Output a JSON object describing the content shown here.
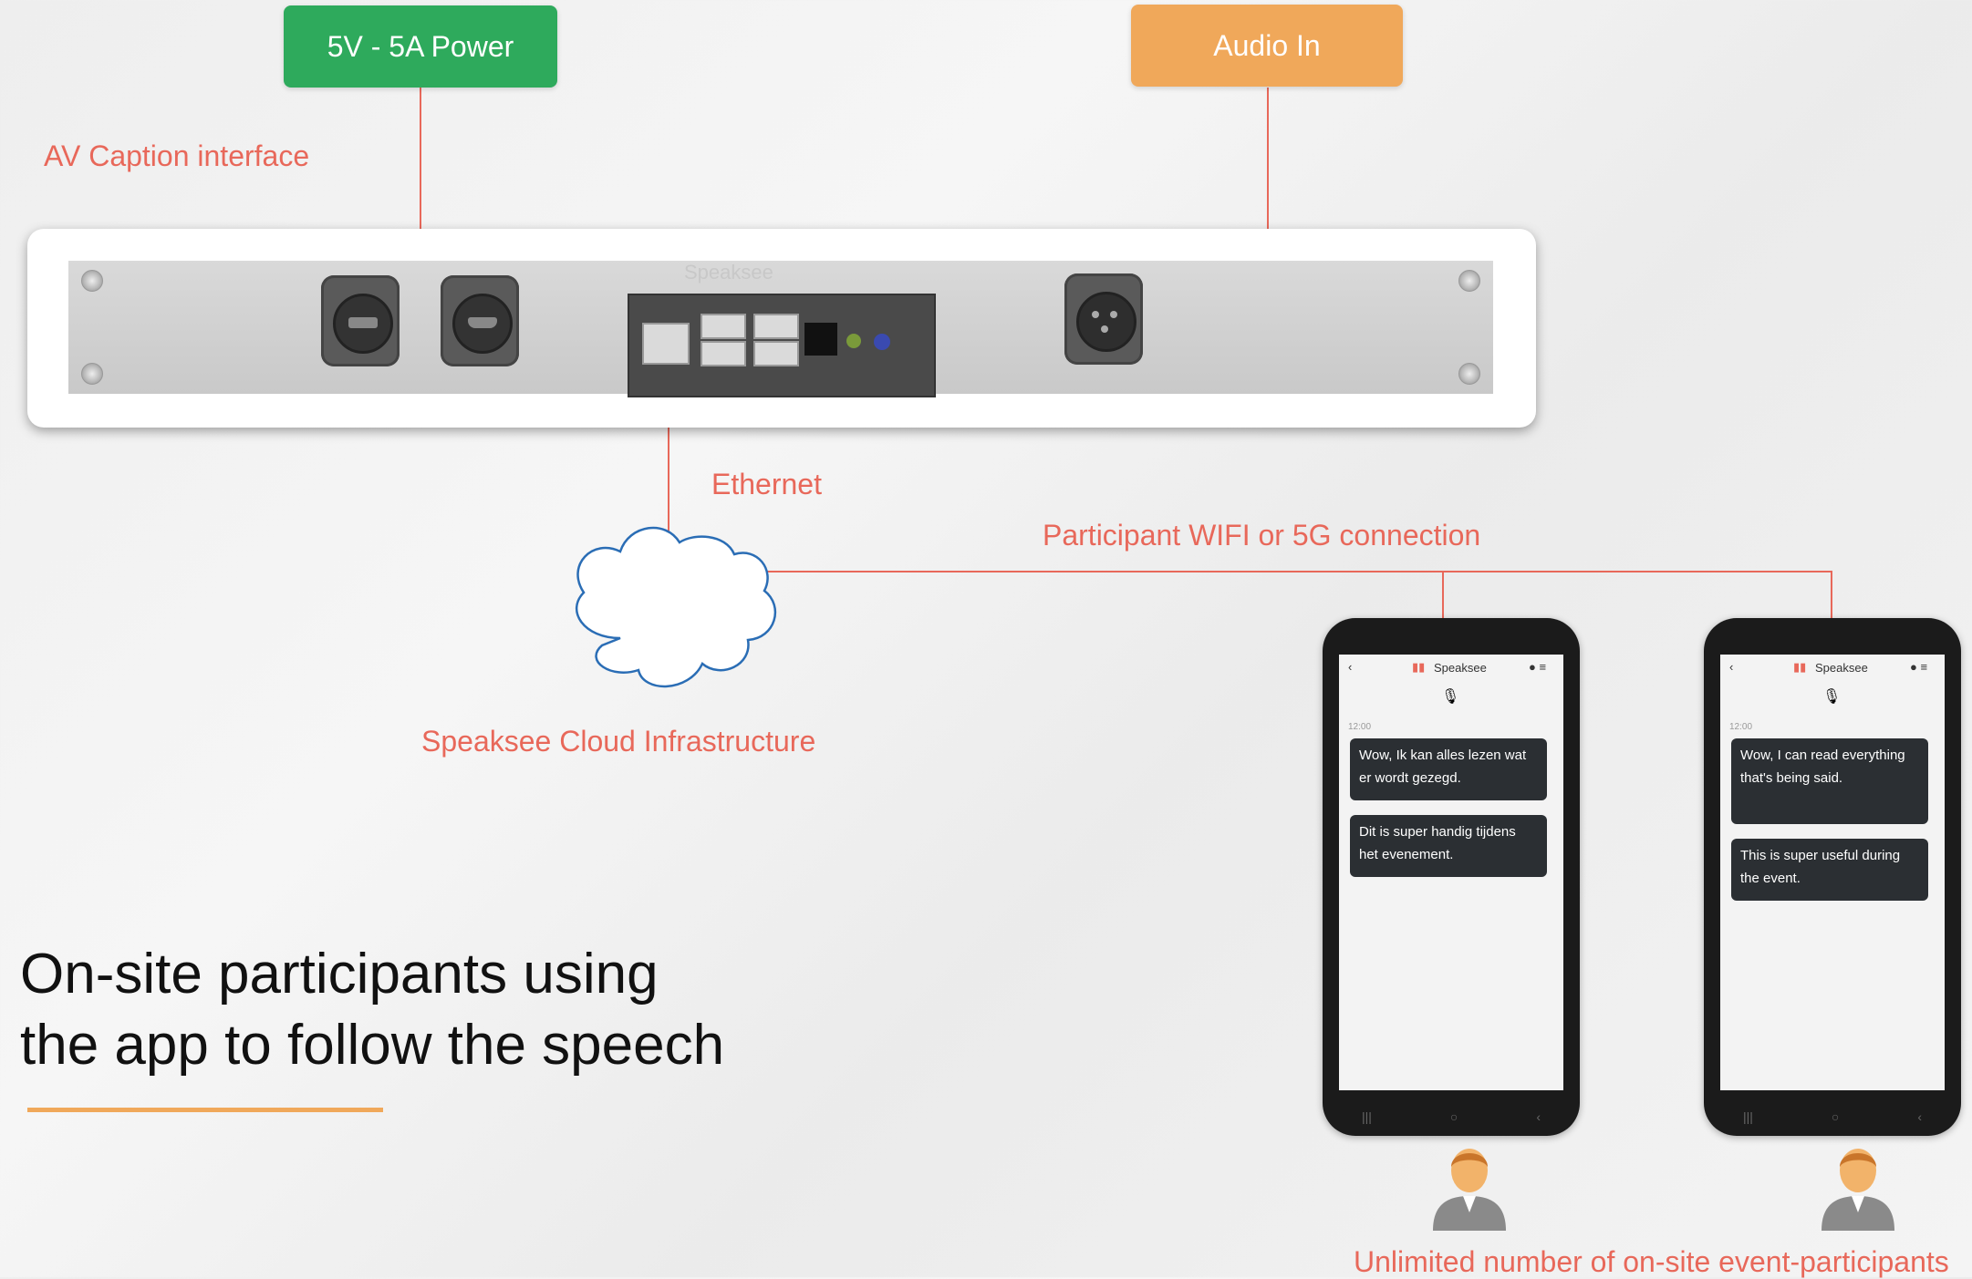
{
  "boxes": {
    "power": {
      "label": "5V - 5A Power",
      "color": "#2eaa5c"
    },
    "audio": {
      "label": "Audio In",
      "color": "#f0a85a"
    }
  },
  "labels": {
    "av_caption": "AV Caption interface",
    "ethernet": "Ethernet",
    "wifi": "Participant WIFI or 5G connection",
    "cloud": "Speaksee Cloud Infrastructure",
    "participants": "Unlimited number of on-site event-participants"
  },
  "device": {
    "brand": "Speaksee"
  },
  "phones": [
    {
      "brand": "Speaksee",
      "time": "12:00",
      "messages": [
        "Wow, Ik kan alles lezen wat er wordt gezegd.",
        "Dit is super handig tijdens het evenement."
      ]
    },
    {
      "brand": "Speaksee",
      "time": "12:00",
      "messages": [
        "Wow, I can read everything that's being said.",
        "This is super useful during the event."
      ]
    }
  ],
  "title": {
    "line1": "On-site participants using",
    "line2": "the app to follow the speech"
  },
  "colors": {
    "line": "#e8685a",
    "accent": "#f0a85a",
    "cloud_stroke": "#2a6db5"
  }
}
